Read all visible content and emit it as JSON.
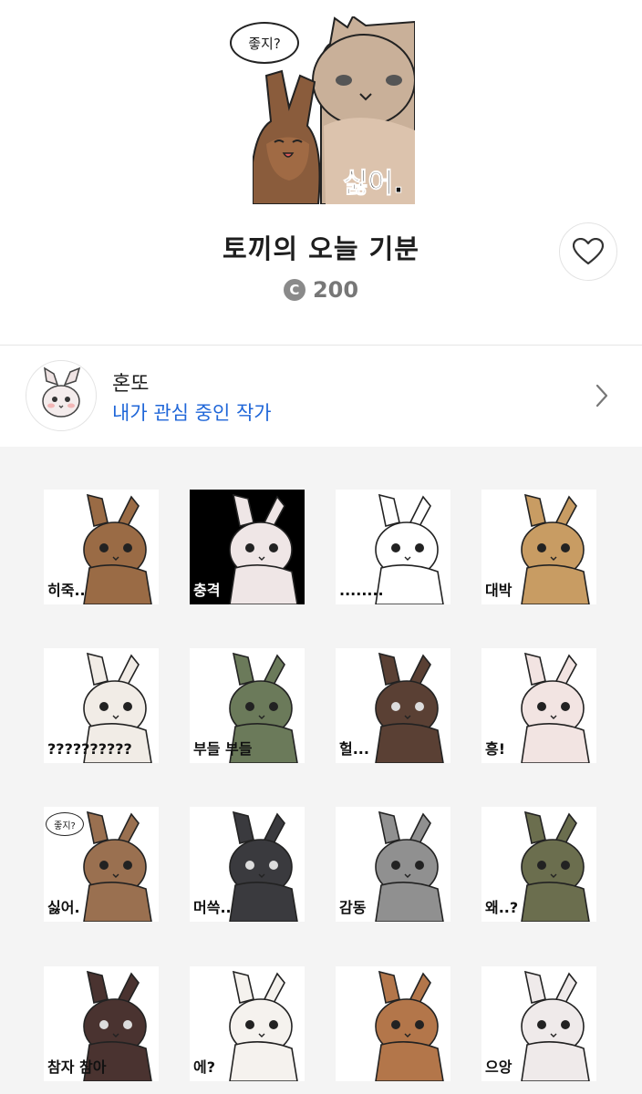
{
  "header": {
    "hero_speech": "좋지?",
    "hero_caption": "싫어.",
    "title": "토끼의 오늘 기분",
    "price_symbol": "C",
    "price": "200",
    "like_icon": "heart-outline-icon"
  },
  "author": {
    "name": "혼또",
    "subtitle": "내가 관심 중인 작가",
    "chevron_icon": "chevron-right-icon"
  },
  "stickers": [
    {
      "caption": "히죽..",
      "bunny_color": "#9a6b45"
    },
    {
      "caption": "충격",
      "bunny_color": "#efe6e6"
    },
    {
      "caption": "........",
      "bunny_color": "#ffffff"
    },
    {
      "caption": "대박",
      "bunny_color": "#c89c63"
    },
    {
      "caption": "??????????",
      "bunny_color": "#f1ece6"
    },
    {
      "caption": "부들 부들",
      "bunny_color": "#6b7a5a"
    },
    {
      "caption": "헐...",
      "bunny_color": "#5a4034"
    },
    {
      "caption": "흥!",
      "bunny_color": "#f2e4e2"
    },
    {
      "caption_speech": "좋지?",
      "caption": "싫어.",
      "bunny_color": "#9a7050"
    },
    {
      "caption": "머쓱..",
      "bunny_color": "#3a3a3e"
    },
    {
      "caption": "감동",
      "bunny_color": "#909090"
    },
    {
      "caption": "왜..?",
      "bunny_color": "#6b6e4e"
    },
    {
      "caption": "참자 참아",
      "bunny_color": "#4a3330"
    },
    {
      "caption": "에?",
      "bunny_color": "#f5f2ee"
    },
    {
      "caption": "",
      "bunny_color": "#b3764a"
    },
    {
      "caption": "으앙",
      "bunny_color": "#efeaea"
    }
  ]
}
